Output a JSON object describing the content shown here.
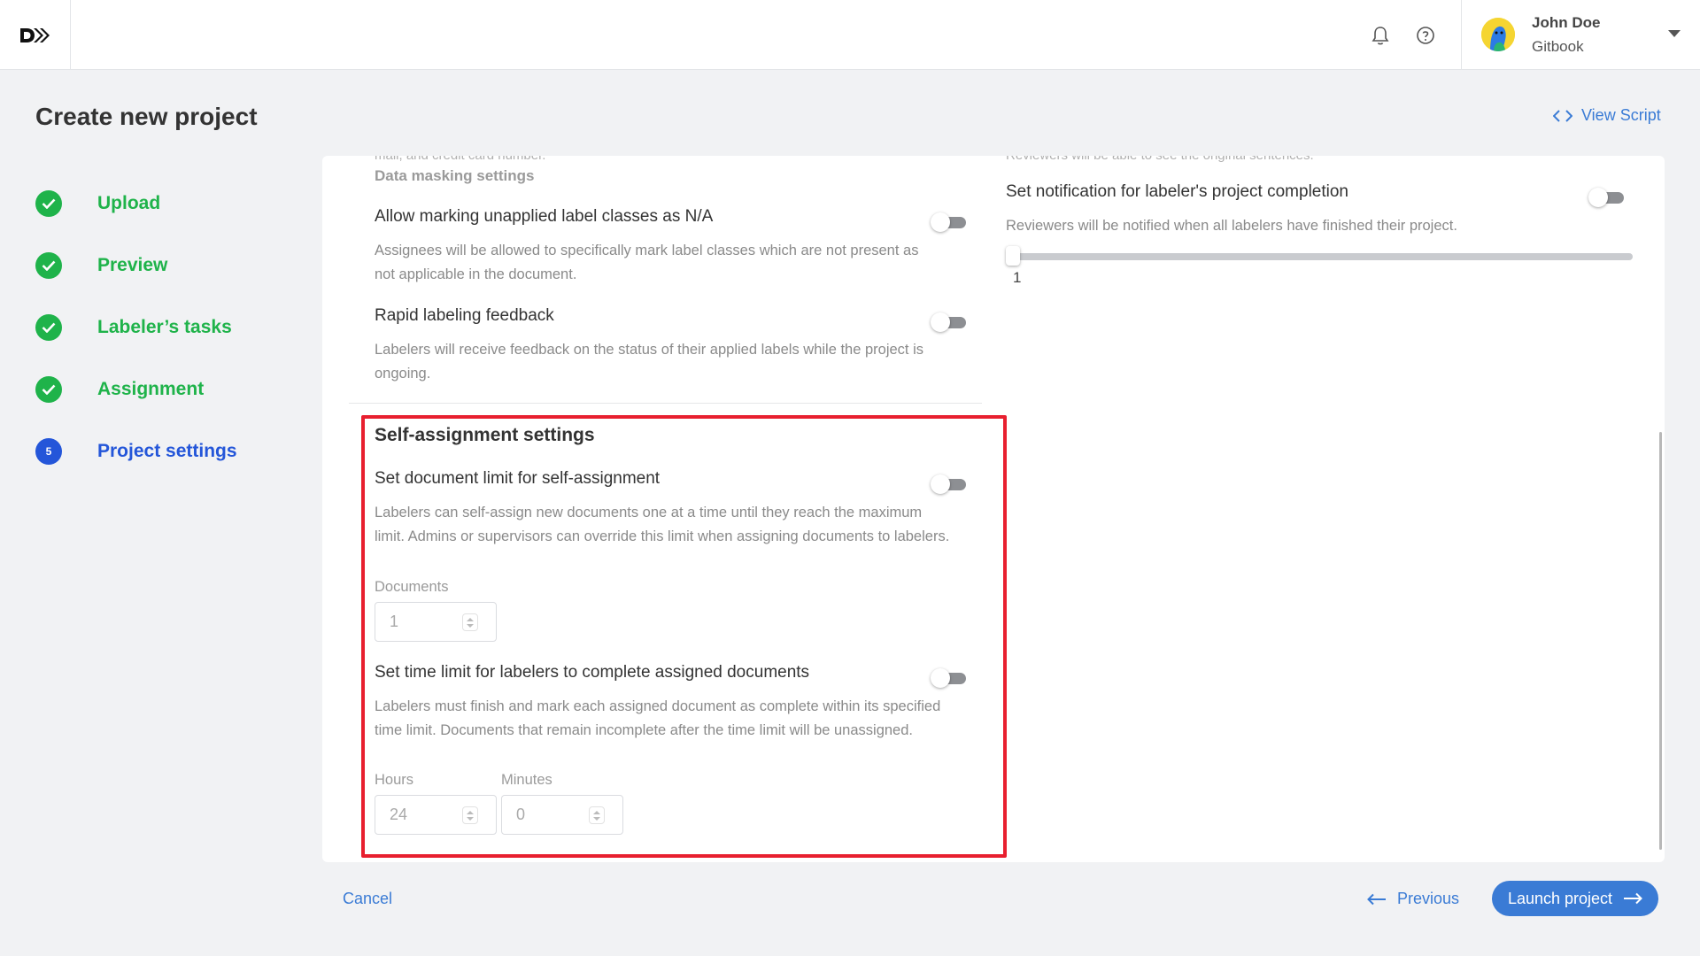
{
  "topbar": {
    "logo_alt": "DataSaur logo",
    "user": {
      "name": "John Doe",
      "org": "Gitbook"
    }
  },
  "page": {
    "title": "Create new project",
    "view_script": "View Script"
  },
  "steps": [
    {
      "label": "Upload",
      "status": "done"
    },
    {
      "label": "Preview",
      "status": "done"
    },
    {
      "label": "Labeler’s tasks",
      "status": "done"
    },
    {
      "label": "Assignment",
      "status": "done"
    },
    {
      "label": "Project settings",
      "status": "current",
      "number": "5"
    }
  ],
  "left": {
    "clipped_top_text": "mail, and credit card number.",
    "data_masking_heading": "Data masking settings",
    "settings": [
      {
        "title": "Allow marking unapplied label classes as N/A",
        "desc": "Assignees will be allowed to specifically mark label classes which are not present as not applicable in the document.",
        "enabled": false
      },
      {
        "title": "Rapid labeling feedback",
        "desc": "Labelers will receive feedback on the status of their applied labels while the project is ongoing.",
        "enabled": false
      }
    ],
    "self_assignment": {
      "heading": "Self-assignment settings",
      "doc_limit": {
        "title": "Set document limit for self-assignment",
        "desc": "Labelers can self-assign new documents one at a time until they reach the maximum limit. Admins or supervisors can override this limit when assigning documents to labelers.",
        "enabled": false,
        "field_label": "Documents",
        "value": "1"
      },
      "time_limit": {
        "title": "Set time limit for labelers to complete assigned documents",
        "desc": "Labelers must finish and mark each assigned document as complete within its specified time limit. Documents that remain incomplete after the time limit will be unassigned.",
        "enabled": false,
        "hours_label": "Hours",
        "hours_value": "24",
        "minutes_label": "Minutes",
        "minutes_value": "0"
      }
    }
  },
  "right": {
    "clipped_top_text": "Reviewers will be able to see the original sentences.",
    "notification": {
      "title": "Set notification for labeler's project completion",
      "desc": "Reviewers will be notified when all labelers have finished their project.",
      "enabled": false,
      "slider_value": "1"
    }
  },
  "footer": {
    "cancel": "Cancel",
    "previous": "Previous",
    "launch": "Launch project"
  },
  "colors": {
    "accent": "#3a7bd5",
    "success": "#1fb34a",
    "current_step": "#2456d9",
    "highlight": "#e81f2f"
  }
}
